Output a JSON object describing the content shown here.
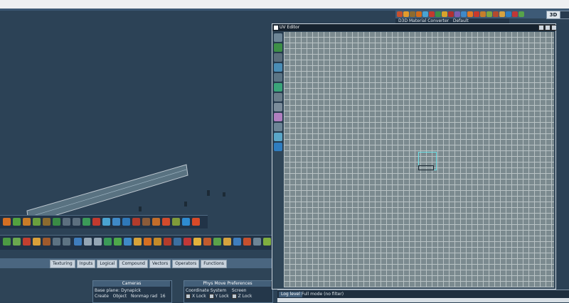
{
  "topbar": {
    "btn_3d": "3D"
  },
  "material_row": {
    "label": "D3D Material Converter",
    "value": "Default"
  },
  "uv_editor": {
    "title": "UV Editor"
  },
  "tabs": [
    "Texturing",
    "Inputs",
    "Logical",
    "Compound",
    "Vectors",
    "Operators",
    "Functions"
  ],
  "cameras_panel": {
    "title": "Cameras",
    "row1": "Base plane: Dynapick",
    "row2_a": "Create",
    "row2_b": "Object",
    "row2_c": "Nonmap rad",
    "row2_val": "16"
  },
  "phys_panel": {
    "title": "Phys Move Preferences",
    "row1_a": "Coordinate System",
    "row1_b": "Screen",
    "lock_x": "X Lock",
    "lock_y": "Y Lock",
    "lock_z": "Z Lock"
  },
  "log_panel": {
    "log_level": "Log level",
    "full_mode": "Full mode (no filter)"
  },
  "colors": {
    "background": "#2c4256",
    "uv_grid": "#7b8a8f",
    "selection": "#6fe3e9"
  },
  "icons": [
    "cube-icon",
    "sphere-icon",
    "cylinder-icon",
    "cone-icon",
    "torus-icon",
    "light-icon",
    "camera-icon"
  ]
}
